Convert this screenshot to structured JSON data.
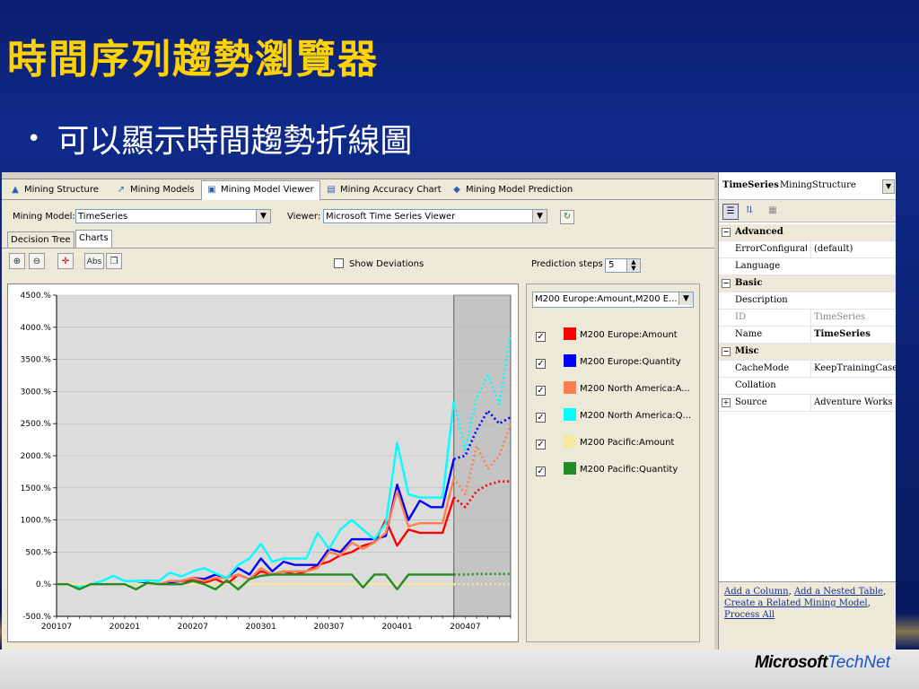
{
  "slide": {
    "title": "時間序列趨勢瀏覽器",
    "bullet": "可以顯示時間趨勢折線圖",
    "bullet_dot": "•",
    "logo_microsoft": "Microsoft",
    "logo_technet": "TechNet"
  },
  "tabs": [
    {
      "label": "Mining Structure",
      "icon": "structure-icon"
    },
    {
      "label": "Mining Models",
      "icon": "models-icon"
    },
    {
      "label": "Mining Model Viewer",
      "icon": "viewer-icon",
      "active": true
    },
    {
      "label": "Mining Accuracy Chart",
      "icon": "accuracy-chart-icon"
    },
    {
      "label": "Mining Model Prediction",
      "icon": "prediction-icon"
    }
  ],
  "model_row": {
    "model_label": "Mining Model:",
    "model_value": "TimeSeries",
    "viewer_label": "Viewer:",
    "viewer_value": "Microsoft Time Series Viewer"
  },
  "subtabs": [
    {
      "label": "Decision Tree"
    },
    {
      "label": "Charts",
      "active": true
    }
  ],
  "toolbar": {
    "show_deviations_label": "Show Deviations",
    "prediction_steps_label": "Prediction steps",
    "prediction_steps_value": "5",
    "abs_label": "Abs"
  },
  "legend": {
    "combo_value": "M200 Europe:Amount,M200 E...",
    "items": [
      {
        "label": "M200 Europe:Amount",
        "color": "#ff0000",
        "checked": true
      },
      {
        "label": "M200 Europe:Quantity",
        "color": "#0000ff",
        "checked": true
      },
      {
        "label": "M200 North America:A...",
        "color": "#ff7f50",
        "checked": true
      },
      {
        "label": "M200 North America:Q...",
        "color": "#00ffff",
        "checked": true
      },
      {
        "label": "M200 Pacific:Amount",
        "color": "#f5e6a0",
        "checked": true
      },
      {
        "label": "M200 Pacific:Quantity",
        "color": "#228b22",
        "checked": true
      }
    ]
  },
  "properties": {
    "object_name": "TimeSeries",
    "object_type": "MiningStructure",
    "rows": [
      {
        "type": "cat",
        "label": "Advanced"
      },
      {
        "type": "prop",
        "key": "ErrorConfigurati",
        "value": "(default)"
      },
      {
        "type": "prop",
        "key": "Language",
        "value": ""
      },
      {
        "type": "cat",
        "label": "Basic"
      },
      {
        "type": "prop",
        "key": "Description",
        "value": ""
      },
      {
        "type": "prop",
        "key": "ID",
        "value": "TimeSeries",
        "dim": true
      },
      {
        "type": "prop",
        "key": "Name",
        "value": "TimeSeries",
        "bold": true
      },
      {
        "type": "cat",
        "label": "Misc"
      },
      {
        "type": "prop",
        "key": "CacheMode",
        "value": "KeepTrainingCases"
      },
      {
        "type": "prop",
        "key": "Collation",
        "value": ""
      },
      {
        "type": "prop",
        "key": "Source",
        "value": "Adventure Works DV",
        "expandable": true
      }
    ],
    "links": [
      "Add a Column",
      "Add a Nested Table",
      "Create a Related Mining Model",
      "Process All"
    ]
  },
  "chart_data": {
    "type": "line",
    "title": "",
    "xlabel": "",
    "ylabel": "",
    "y_unit": "%",
    "ylim": [
      -500,
      4500
    ],
    "yticks": [
      "4500.%",
      "4000.%",
      "3500.%",
      "3000.%",
      "2500.%",
      "2000.%",
      "1500.%",
      "1000.%",
      "500.%",
      "0.%",
      "-500.%"
    ],
    "x_tick_labels": [
      "200107",
      "200201",
      "200207",
      "200301",
      "200307",
      "200401",
      "200407"
    ],
    "x_tick_index": [
      0,
      6,
      12,
      18,
      24,
      30,
      36
    ],
    "x_range_index": [
      0,
      40
    ],
    "prediction_start_index": 35,
    "grid": "horizontal",
    "series": [
      {
        "name": "M200 Europe:Amount",
        "color": "#ff0000",
        "values": [
          0,
          0,
          -50,
          0,
          0,
          0,
          0,
          0,
          0,
          0,
          30,
          50,
          60,
          20,
          80,
          0,
          150,
          80,
          200,
          150,
          200,
          150,
          200,
          300,
          350,
          450,
          500,
          600,
          650,
          1000,
          600,
          850,
          800,
          800,
          800,
          1350,
          1200,
          1450,
          1550,
          1600,
          1600
        ]
      },
      {
        "name": "M200 Europe:Quantity",
        "color": "#0000ff",
        "values": [
          0,
          0,
          -50,
          0,
          0,
          0,
          0,
          0,
          20,
          0,
          30,
          50,
          100,
          80,
          150,
          100,
          250,
          150,
          400,
          200,
          350,
          300,
          300,
          300,
          550,
          500,
          700,
          700,
          700,
          750,
          1550,
          1000,
          1300,
          1200,
          1200,
          1950,
          2000,
          2400,
          2700,
          2500,
          2600
        ]
      },
      {
        "name": "M200 North America:Amount",
        "color": "#ff7f50",
        "values": [
          0,
          0,
          -50,
          0,
          0,
          0,
          0,
          0,
          0,
          0,
          50,
          50,
          100,
          50,
          100,
          100,
          150,
          80,
          250,
          150,
          200,
          200,
          200,
          250,
          500,
          450,
          650,
          550,
          650,
          800,
          1450,
          900,
          950,
          950,
          950,
          1650,
          1400,
          2150,
          1800,
          2000,
          2500
        ]
      },
      {
        "name": "M200 North America:Quantity",
        "color": "#00ffff",
        "values": [
          0,
          0,
          -50,
          0,
          50,
          130,
          50,
          50,
          60,
          50,
          180,
          120,
          200,
          250,
          170,
          100,
          300,
          400,
          630,
          350,
          400,
          400,
          400,
          800,
          550,
          850,
          1000,
          850,
          700,
          950,
          2200,
          1400,
          1350,
          1350,
          1350,
          2850,
          2100,
          2900,
          3250,
          2800,
          3900
        ]
      },
      {
        "name": "M200 Pacific:Amount",
        "color": "#f5e6a0",
        "values": [
          0,
          0,
          0,
          0,
          0,
          0,
          0,
          0,
          0,
          0,
          0,
          0,
          0,
          0,
          0,
          0,
          0,
          0,
          0,
          0,
          0,
          0,
          0,
          0,
          0,
          0,
          0,
          0,
          0,
          0,
          0,
          0,
          0,
          0,
          0,
          0,
          0,
          0,
          0,
          0,
          0
        ]
      },
      {
        "name": "M200 Pacific:Quantity",
        "color": "#228b22",
        "values": [
          0,
          0,
          -80,
          0,
          0,
          0,
          0,
          -80,
          20,
          0,
          0,
          0,
          50,
          0,
          -80,
          60,
          -80,
          80,
          130,
          150,
          150,
          150,
          150,
          150,
          150,
          150,
          150,
          -50,
          150,
          150,
          -80,
          150,
          150,
          150,
          150,
          150,
          150,
          160,
          160,
          160,
          160
        ]
      }
    ]
  }
}
